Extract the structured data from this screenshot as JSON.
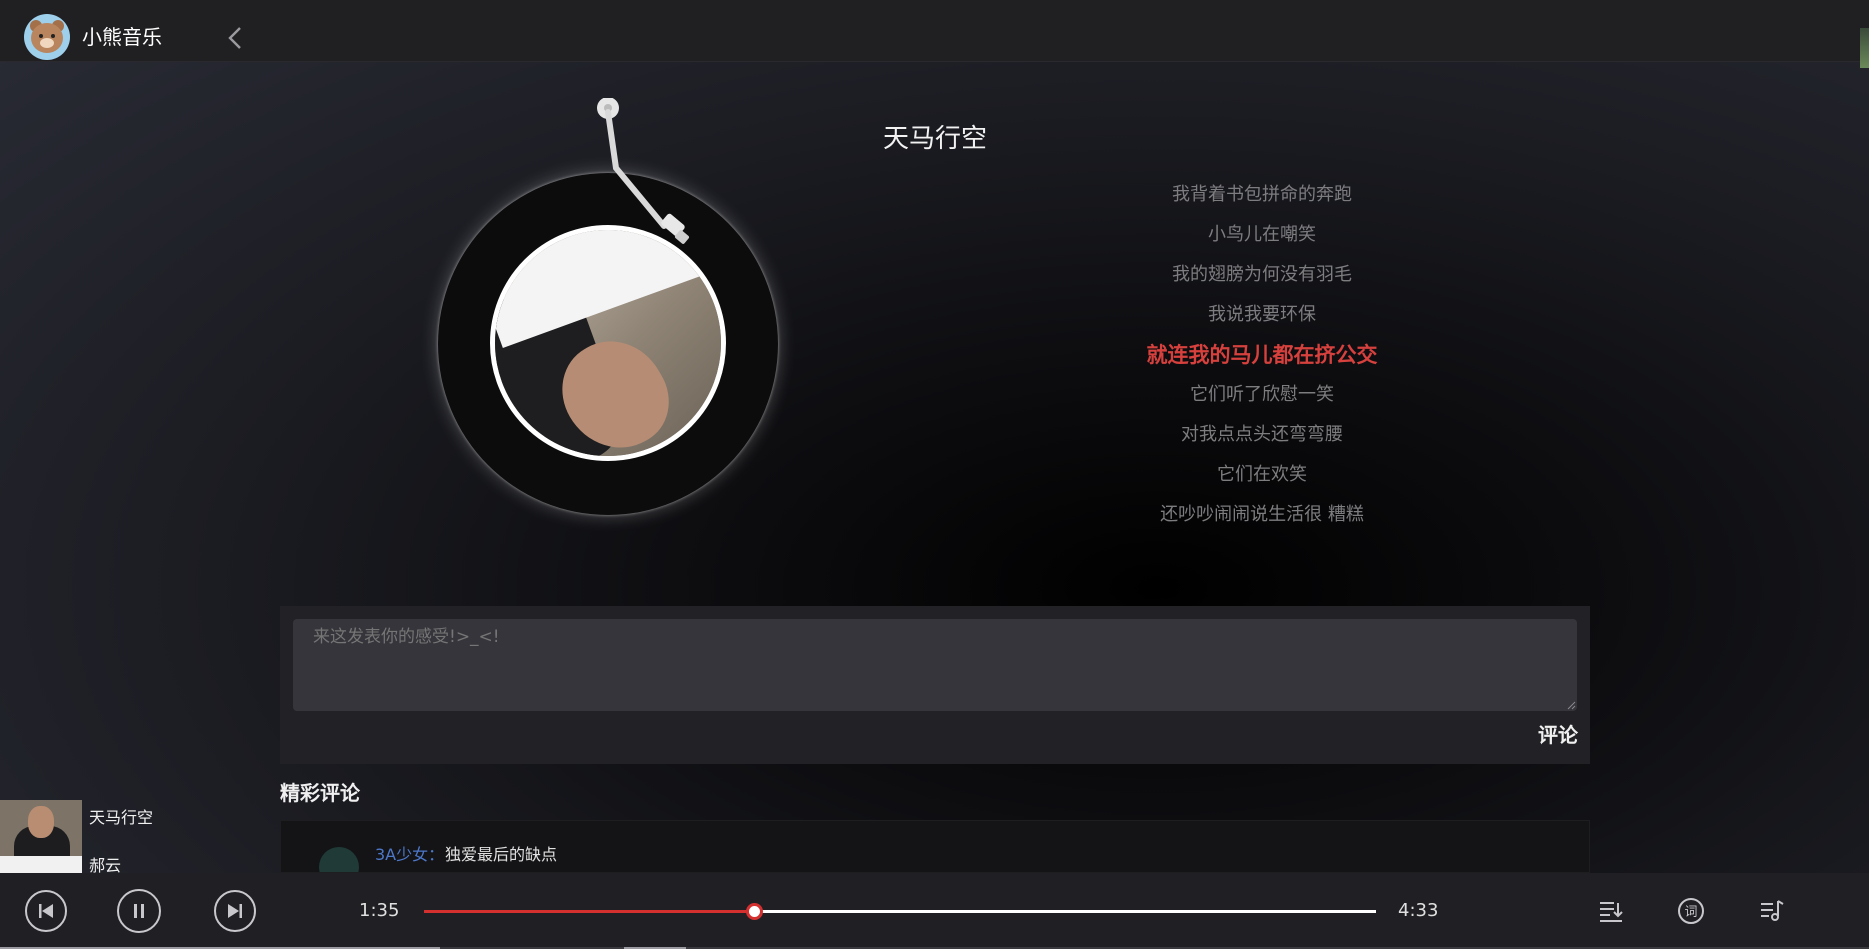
{
  "header": {
    "app_title": "小熊音乐",
    "logo_icon": "bear-avatar-icon",
    "back_icon": "chevron-left-icon"
  },
  "song": {
    "title": "天马行空"
  },
  "lyrics": [
    "我背着书包拼命的奔跑",
    "小鸟儿在嘲笑",
    "我的翅膀为何没有羽毛",
    "我说我要环保",
    "就连我的马儿都在挤公交",
    "它们听了欣慰一笑",
    "对我点点头还弯弯腰",
    "它们在欢笑",
    "还吵吵闹闹说生活很 糟糕"
  ],
  "lyrics_active_index": 4,
  "comment_box": {
    "placeholder": "来这发表你的感受!>_<!",
    "submit_label": "评论"
  },
  "hot_comments": {
    "title": "精彩评论",
    "items": [
      {
        "user": "3A少女：",
        "text": "独爱最后的缺点"
      }
    ]
  },
  "mini_playlist": [
    {
      "title": "天马行空"
    },
    {
      "title": "郝云"
    }
  ],
  "player": {
    "current_time": "1:35",
    "total_time": "4:33",
    "progress": 0.348,
    "prev_icon": "skip-previous-icon",
    "pause_icon": "pause-icon",
    "next_icon": "skip-next-icon",
    "playlist_icon": "playlist-icon",
    "lyrics_icon": "lyrics-icon",
    "queue_icon": "music-queue-icon"
  },
  "colors": {
    "accent": "#d53030",
    "active_lyric": "#d6403d",
    "username": "#4d78c9"
  }
}
